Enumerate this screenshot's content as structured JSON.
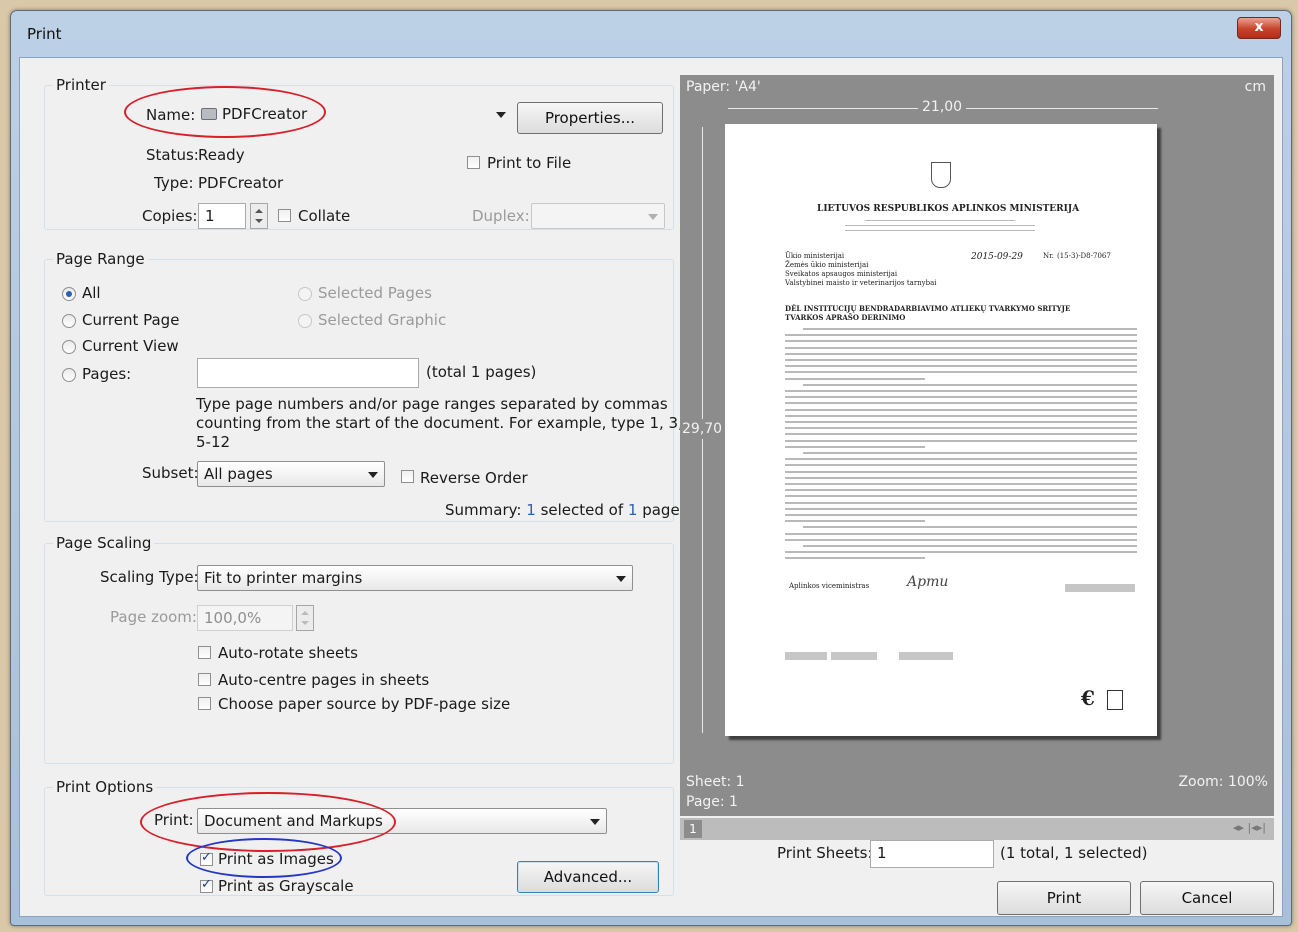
{
  "window": {
    "title": "Print",
    "close_label": "x"
  },
  "printer": {
    "legend": "Printer",
    "name_label": "Name:",
    "name_value": "PDFCreator",
    "properties_label": "Properties...",
    "status_label": "Status:",
    "status_value": "Ready",
    "type_label": "Type:",
    "type_value": "PDFCreator",
    "print_to_file_label": "Print to File",
    "copies_label": "Copies:",
    "copies_value": "1",
    "collate_label": "Collate",
    "duplex_label": "Duplex:"
  },
  "page_range": {
    "legend": "Page Range",
    "all_label": "All",
    "current_page_label": "Current Page",
    "current_view_label": "Current View",
    "pages_label": "Pages:",
    "selected_pages_label": "Selected Pages",
    "selected_graphic_label": "Selected Graphic",
    "total_pages_label": "(total 1 pages)",
    "help_line1": "Type page numbers and/or page ranges separated by commas",
    "help_line2": "counting from the start of the document. For example, type 1, 3,",
    "help_line3": "5-12",
    "subset_label": "Subset:",
    "subset_value": "All pages",
    "reverse_order_label": "Reverse Order",
    "summary_prefix": "Summary:",
    "summary_selected": "1",
    "summary_mid": "selected of",
    "summary_total": "1",
    "summary_suffix": "pages"
  },
  "page_scaling": {
    "legend": "Page Scaling",
    "scaling_type_label": "Scaling Type:",
    "scaling_type_value": "Fit to printer margins",
    "page_zoom_label": "Page zoom:",
    "page_zoom_value": "100,0%",
    "auto_rotate_label": "Auto-rotate sheets",
    "auto_centre_label": "Auto-centre pages in sheets",
    "paper_source_label": "Choose paper source by PDF-page size"
  },
  "print_options": {
    "legend": "Print Options",
    "print_label": "Print:",
    "print_value": "Document and Markups",
    "print_as_images_label": "Print as Images",
    "print_as_grayscale_label": "Print as Grayscale",
    "advanced_label": "Advanced..."
  },
  "preview": {
    "paper_label": "Paper: 'A4'",
    "unit_label": "cm",
    "width_value": "21,00",
    "height_value": "29,70",
    "sheet_label": "Sheet: 1",
    "page_label": "Page: 1",
    "zoom_label": "Zoom: 100%",
    "pager_value": "1"
  },
  "document": {
    "ministry_title": "LIETUVOS RESPUBLIKOS APLINKOS MINISTERIJA",
    "recipient_1": "Ūkio ministerijai",
    "recipient_2": "Žemės ūkio ministerijai",
    "recipient_3": "Sveikatos apsaugos ministerijai",
    "recipient_4": "Valstybinei maisto ir veterinarijos tarnybai",
    "date_value": "2015-09-29",
    "number_label": "Nr.",
    "number_value": "(15-3)-D8-7067",
    "subject_1": "DĖL INSTITUCIJŲ BENDRADARBIAVIMO ATLIEKŲ TVARKYMO SRITYJE",
    "subject_2": "TVARKOS APRAŠO DERINIMO",
    "signer_title": "Aplinkos viceministras",
    "signature": "Apmu"
  },
  "footer": {
    "print_sheets_label": "Print Sheets:",
    "print_sheets_value": "1",
    "print_sheets_info": "(1 total, 1 selected)",
    "print_button": "Print",
    "cancel_button": "Cancel"
  },
  "colors": {
    "accent": "#2b61b3",
    "annotation_red": "#d8202a",
    "annotation_blue": "#2437c8"
  }
}
